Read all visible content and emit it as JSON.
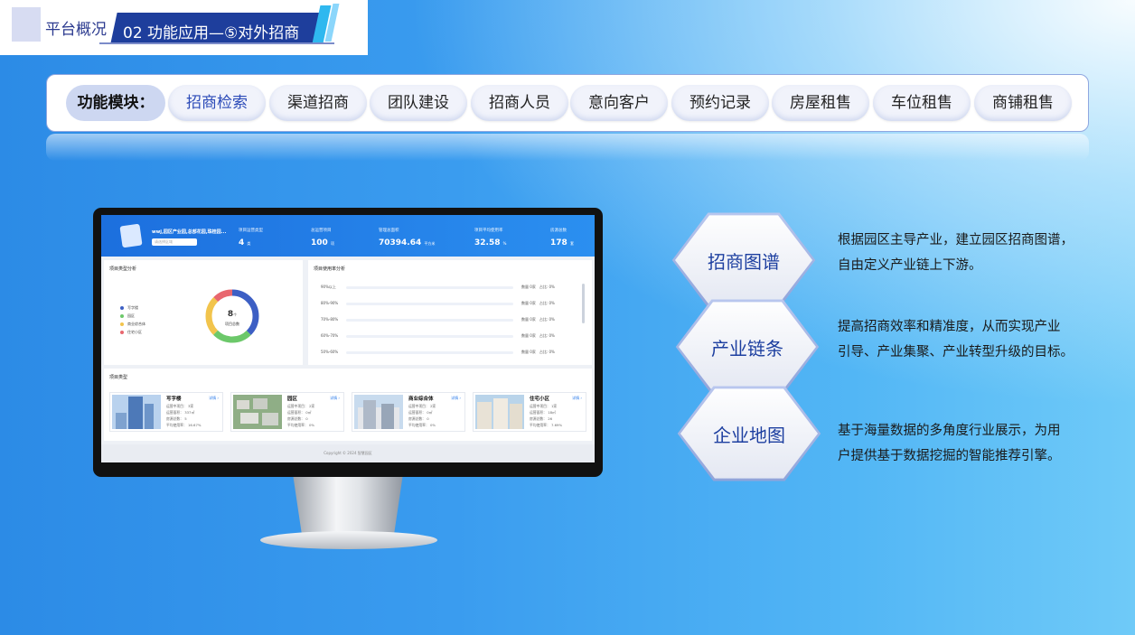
{
  "header": {
    "section": "平台概况",
    "title": "02 功能应用—⑤对外招商"
  },
  "modules": {
    "label": "功能模块：",
    "items": [
      "招商检索",
      "渠道招商",
      "团队建设",
      "招商人员",
      "意向客户",
      "预约记录",
      "房屋租售",
      "车位租售",
      "商铺租售"
    ]
  },
  "screen": {
    "park_name": "wwj,园区产业园,总部花园,珠桂园...",
    "search_placeholder": "请选择区域",
    "stats": [
      {
        "label": "项目运营类型",
        "value": "4",
        "unit": "类"
      },
      {
        "label": "总运营项目",
        "value": "100",
        "unit": "项"
      },
      {
        "label": "管理总面积",
        "value": "70394.64",
        "unit": "平方米"
      },
      {
        "label": "项目平均使用率",
        "value": "32.58",
        "unit": "%"
      },
      {
        "label": "房源总数",
        "value": "178",
        "unit": "套"
      }
    ],
    "type_analysis": {
      "title": "项目类型分析",
      "legend": [
        "写字楼",
        "园区",
        "商业综合体",
        "住宅小区"
      ],
      "center_value": "8",
      "center_unit": "个",
      "center_label": "项目总数"
    },
    "usage_analysis": {
      "title": "项目使用率分析",
      "rows": [
        {
          "range": "90%以上",
          "count": "数量 0家",
          "ratio": "占比: 0%"
        },
        {
          "range": "80%-90%",
          "count": "数量 0家",
          "ratio": "占比: 0%"
        },
        {
          "range": "70%-80%",
          "count": "数量 0家",
          "ratio": "占比: 0%"
        },
        {
          "range": "60%-70%",
          "count": "数量 0家",
          "ratio": "占比: 0%"
        },
        {
          "range": "50%-60%",
          "count": "数量 0家",
          "ratio": "占比: 0%"
        }
      ]
    },
    "project_types": {
      "title": "项目类型",
      "detail": "详情 ›",
      "items": [
        {
          "name": "写字楼",
          "l1": "运营中项目： 3家",
          "l2": "运营面积： 337㎡",
          "l3": "房源总数： 5",
          "l4": "平均使用率： 16.67%"
        },
        {
          "name": "园区",
          "l1": "运营中项目： 2家",
          "l2": "运营面积： 0㎡",
          "l3": "房源总数： 0",
          "l4": "平均使用率： 0%"
        },
        {
          "name": "商业综合体",
          "l1": "运营中项目： 2家",
          "l2": "运营面积： 0㎡",
          "l3": "房源总数： 0",
          "l4": "平均使用率： 0%"
        },
        {
          "name": "住宅小区",
          "l1": "运营中项目： 1家",
          "l2": "运营面积： 18㎡",
          "l3": "房源总数： 26",
          "l4": "平均使用率： 7.69%"
        }
      ]
    },
    "copyright": "Copyright © 2024 智慧园区"
  },
  "features": [
    {
      "title": "招商图谱",
      "desc1": "根据园区主导产业，建立园区招商图谱，",
      "desc2": "自由定义产业链上下游。"
    },
    {
      "title": "产业链条",
      "desc1": "提高招商效率和精准度，从而实现产业",
      "desc2": "引导、产业集聚、产业转型升级的目标。"
    },
    {
      "title": "企业地图",
      "desc1": "基于海量数据的多角度行业展示，为用",
      "desc2": "户提供基于数据挖掘的智能推荐引擎。"
    }
  ],
  "colors": {
    "legend": [
      "#3d5fc4",
      "#6cc86a",
      "#f2c44c",
      "#e8676f"
    ],
    "accent": "#1e3e9c"
  }
}
